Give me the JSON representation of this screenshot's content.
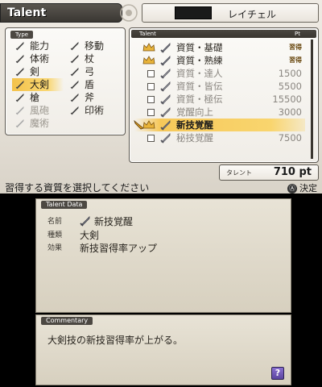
{
  "header": {
    "title": "Talent",
    "character_name": "レイチェル"
  },
  "type_panel": {
    "heading": "Type",
    "items": [
      {
        "label": "能力",
        "icon": "ability-icon",
        "state": "normal"
      },
      {
        "label": "移動",
        "icon": "movement-icon",
        "state": "normal"
      },
      {
        "label": "体術",
        "icon": "fist-icon",
        "state": "normal"
      },
      {
        "label": "杖",
        "icon": "staff-icon",
        "state": "normal"
      },
      {
        "label": "剣",
        "icon": "sword-icon",
        "state": "normal"
      },
      {
        "label": "弓",
        "icon": "bow-icon",
        "state": "normal"
      },
      {
        "label": "大剣",
        "icon": "greatsword-icon",
        "state": "selected"
      },
      {
        "label": "盾",
        "icon": "shield-icon",
        "state": "normal"
      },
      {
        "label": "槍",
        "icon": "spear-icon",
        "state": "normal"
      },
      {
        "label": "斧",
        "icon": "axe-icon",
        "state": "normal"
      },
      {
        "label": "風砲",
        "icon": "wind-cannon-icon",
        "state": "disabled"
      },
      {
        "label": "印術",
        "icon": "seal-icon",
        "state": "normal"
      },
      {
        "label": "魔術",
        "icon": "magic-icon",
        "state": "disabled"
      }
    ]
  },
  "talent_panel": {
    "heading": "Talent",
    "pt_heading": "Pt",
    "rows": [
      {
        "name": "資質・基礎",
        "pt": "習得",
        "learned": true
      },
      {
        "name": "資質・熟練",
        "pt": "習得",
        "learned": true
      },
      {
        "name": "資質・達人",
        "pt": "1500",
        "learned": false
      },
      {
        "name": "資質・皆伝",
        "pt": "5500",
        "learned": false
      },
      {
        "name": "資質・極伝",
        "pt": "15500",
        "learned": false
      },
      {
        "name": "覚醒向上",
        "pt": "3000",
        "learned": false
      },
      {
        "name": "新技覚醒",
        "pt": "",
        "learned": true,
        "selected": true
      },
      {
        "name": "秘技覚醒",
        "pt": "7500",
        "learned": false
      }
    ]
  },
  "points": {
    "label": "タレント",
    "value": "710 pt"
  },
  "instruction": "習得する資質を選択してください",
  "confirm": {
    "button": "Ⓐ",
    "label": "決定"
  },
  "talent_data": {
    "heading": "Talent Data",
    "name_key": "名前",
    "name_value": "新技覚醒",
    "type_key": "種類",
    "type_value": "大剣",
    "effect_key": "効果",
    "effect_value": "新技習得率アップ"
  },
  "commentary": {
    "heading": "Commentary",
    "text": "大剣技の新技習得率が上がる。"
  },
  "help_button": "?",
  "colors": {
    "selection": "#f6c85a",
    "panel_border": "#5c5850",
    "header_bar": "#4a4640"
  }
}
